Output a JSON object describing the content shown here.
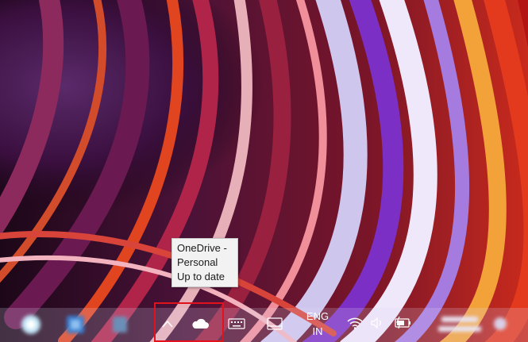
{
  "tooltip": {
    "line1": "OneDrive -",
    "line2": "Personal",
    "line3": "Up to date"
  },
  "taskbar": {
    "pinned_apps": [
      {
        "icon": "blurred-app-icon"
      },
      {
        "icon": "blurred-app-icon"
      },
      {
        "icon": "blurred-app-icon"
      }
    ],
    "tray": {
      "overflow_icon": "chevron-up-icon",
      "onedrive_icon": "cloud-icon",
      "keyboard_icon": "keyboard-icon",
      "tablet_icon": "tablet-mode-icon",
      "language_line1": "ENG",
      "language_line2": "IN",
      "wifi_icon": "wifi-icon",
      "volume_icon": "speaker-icon",
      "battery_icon": "battery-charging-icon"
    },
    "clock_blurred": true
  },
  "colors": {
    "highlight": "#e1121b",
    "tooltip_bg": "#f2f2f2"
  }
}
